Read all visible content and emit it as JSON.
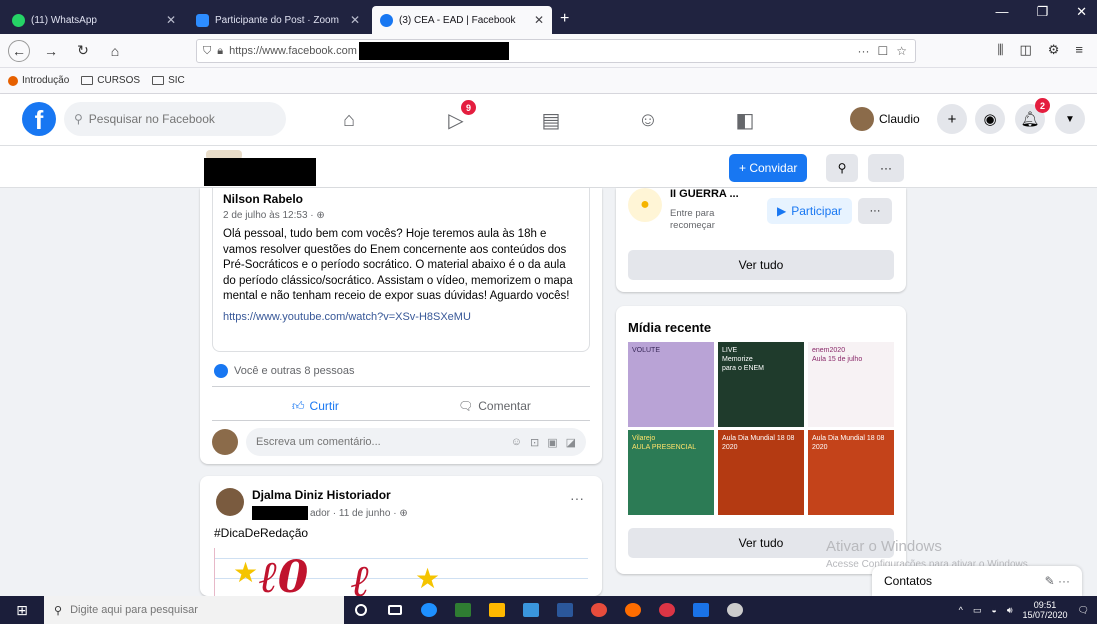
{
  "browser": {
    "tabs": [
      {
        "title": "(11) WhatsApp",
        "color": "#25d366",
        "active": false
      },
      {
        "title": "Participante do Post · Zoom",
        "color": "#2d8cff",
        "active": false
      },
      {
        "title": "(3) CEA - EAD | Facebook",
        "color": "#1877f2",
        "active": true
      }
    ],
    "new_tab": "+",
    "window_controls": [
      "—",
      "❐",
      "✕"
    ],
    "url": "https://www.facebook.com",
    "url_right_icons": [
      "···",
      "☐",
      "☆"
    ],
    "bookmarks": [
      "Introdução",
      "CURSOS",
      "SIC"
    ]
  },
  "facebook": {
    "logo": "f",
    "search_placeholder": "Pesquisar no Facebook",
    "nav_badges": {
      "watch": "9",
      "notifications": "2"
    },
    "profile_name": "Claudio",
    "invite_label": "+ Convidar",
    "more": "···"
  },
  "post1": {
    "author": "Nilson Rabelo",
    "meta": "2 de julho às 12:53 · ⊕",
    "text": "Olá pessoal, tudo bem com vocês? Hoje teremos aula às 18h e vamos resolver questões do Enem concernente aos conteúdos dos Pré-Socráticos e o período socrático. O material abaixo é o da aula do período clássico/socrático. Assistam o vídeo, memorizem o mapa mental e não tenham receio de expor suas dúvidas! Aguardo vocês!",
    "link": "https://www.youtube.com/watch?v=XSv-H8SXeMU",
    "reactions": "Você e outras 8 pessoas",
    "like_label": "Curtir",
    "comment_label": "Comentar",
    "comment_placeholder": "Escreva um comentário..."
  },
  "post2": {
    "author": "Djalma Diniz Historiador",
    "meta": "ador · 11 de junho · ⊕",
    "hashtag": "#DicaDeRedação"
  },
  "event": {
    "title": "II GUERRA ...",
    "subtitle": "Entre para recomeçar",
    "join_label": "Participar",
    "see_all": "Ver tudo"
  },
  "media": {
    "title": "Mídia recente",
    "see_all": "Ver tudo",
    "thumbs": [
      {
        "bg": "#b9a3d6",
        "text": "VOLUTE"
      },
      {
        "bg": "#1f3b2c",
        "text": "LIVE\nMemorize\npara o ENEM"
      },
      {
        "bg": "#f7f2f4",
        "text": "enem2020\nAula 15 de julho"
      },
      {
        "bg": "#2c7b55",
        "text": "Vilarejo\nAULA PRESENCIAL"
      },
      {
        "bg": "#b43a12",
        "text": "Aula Dia Mundial 18 08 2020"
      },
      {
        "bg": "#c4431a",
        "text": "Aula Dia Mundial 18 08 2020"
      }
    ]
  },
  "watermark": {
    "title": "Ativar o Windows",
    "subtitle": "Acesse Configurações para ativar o Windows."
  },
  "contacts": {
    "label": "Contatos",
    "icons": "✎  ···"
  },
  "taskbar": {
    "search_placeholder": "Digite aqui para pesquisar",
    "time": "09:51",
    "date": "15/07/2020",
    "app_colors": [
      "#ffffff",
      "#ffffff",
      "#1e90ff",
      "#2f7d32",
      "#ffb900",
      "#3a96dd",
      "#2b579a",
      "#e74c3c",
      "#ff6d00",
      "#dc3545",
      "#1a73e8",
      "#cccccc"
    ]
  }
}
